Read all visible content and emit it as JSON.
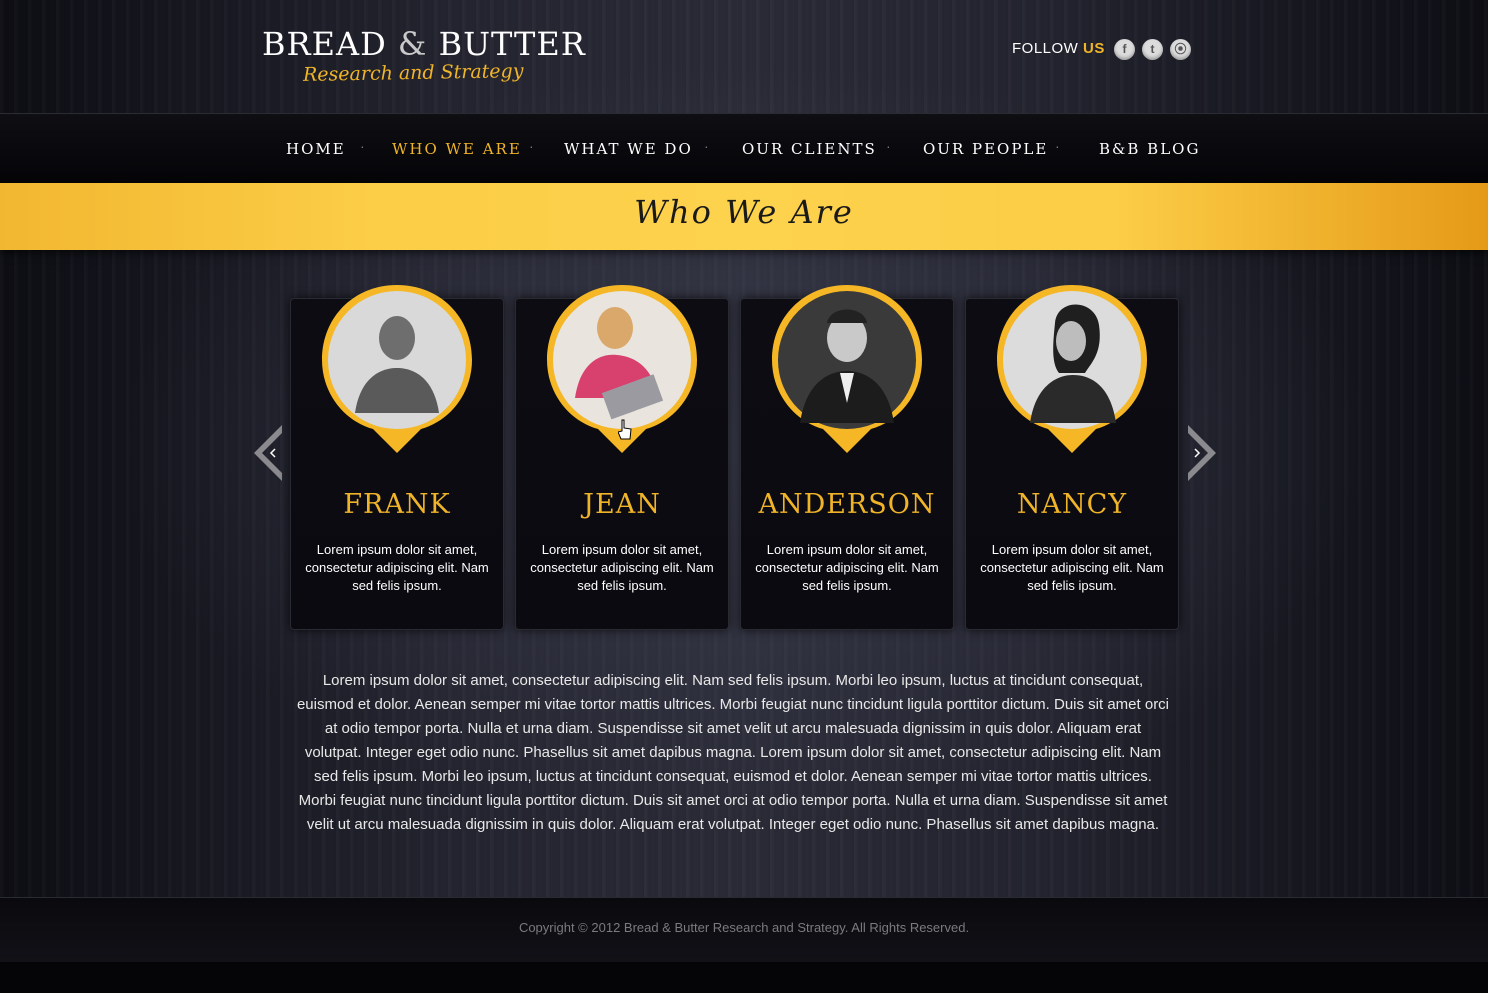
{
  "header": {
    "logo_title": "BREAD",
    "logo_amp": "&",
    "logo_title2": "BUTTER",
    "logo_subtitle": "Research and Strategy",
    "follow_label": "FOLLOW",
    "follow_us": "US",
    "social": [
      {
        "icon": "facebook-icon",
        "glyph": "f"
      },
      {
        "icon": "twitter-icon",
        "glyph": "t"
      },
      {
        "icon": "rss-icon",
        "glyph": "⦿"
      }
    ]
  },
  "nav": {
    "items": [
      {
        "label": "HOME"
      },
      {
        "label": "WHO WE ARE",
        "active": true
      },
      {
        "label": "WHAT WE DO"
      },
      {
        "label": "OUR CLIENTS"
      },
      {
        "label": "OUR PEOPLE"
      },
      {
        "label": "B&B BLOG"
      }
    ]
  },
  "banner": {
    "title": "Who We Are"
  },
  "people": [
    {
      "name": "FRANK",
      "desc": "Lorem ipsum dolor sit amet, consectetur adipiscing elit. Nam sed felis ipsum."
    },
    {
      "name": "JEAN",
      "desc": "Lorem ipsum dolor sit amet, consectetur adipiscing elit. Nam sed felis ipsum."
    },
    {
      "name": "ANDERSON",
      "desc": "Lorem ipsum dolor sit amet, consectetur adipiscing elit. Nam sed felis ipsum."
    },
    {
      "name": "NANCY",
      "desc": "Lorem ipsum dolor sit amet, consectetur adipiscing elit. Nam sed felis ipsum."
    }
  ],
  "body_text": "Lorem ipsum dolor sit amet, consectetur adipiscing elit. Nam sed felis ipsum. Morbi leo ipsum, luctus at tincidunt consequat, euismod et dolor. Aenean semper mi vitae tortor mattis ultrices. Morbi feugiat nunc tincidunt ligula porttitor dictum. Duis sit amet orci at odio tempor porta. Nulla et urna diam. Suspendisse sit amet velit ut arcu malesuada dignissim in quis dolor. Aliquam erat volutpat. Integer eget odio nunc. Phasellus sit amet dapibus magna. Lorem ipsum dolor sit amet, consectetur adipiscing elit. Nam sed felis ipsum. Morbi leo ipsum, luctus at tincidunt consequat, euismod et dolor. Aenean semper mi vitae tortor mattis ultrices. Morbi feugiat nunc tincidunt ligula porttitor dictum. Duis sit amet orci at odio tempor porta. Nulla et urna diam. Suspendisse sit amet velit ut arcu malesuada dignissim in quis dolor. Aliquam erat volutpat. Integer eget odio nunc. Phasellus sit amet dapibus magna.",
  "footer": {
    "copyright": "Copyright © 2012 Bread & Butter Research and Strategy. All Rights Reserved."
  },
  "colors": {
    "accent": "#f0b429",
    "background": "#1b1c26",
    "banner": "#fccd47"
  }
}
